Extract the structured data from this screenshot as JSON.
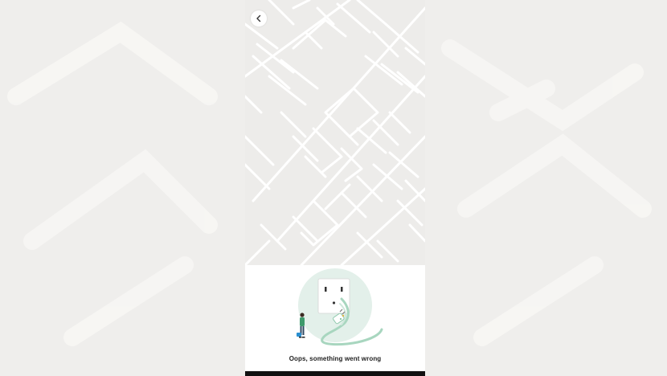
{
  "screen": {
    "back_button": {
      "icon": "chevron-left-icon"
    },
    "error": {
      "message": "Oops, something went wrong"
    },
    "illustration": {
      "icons": [
        "wall-outlet-icon",
        "unplugged-cable-icon",
        "person-icon"
      ],
      "accent_color": "#d8ebe2",
      "line_color": "#9fd1b8"
    }
  },
  "colors": {
    "map_background": "#edecea",
    "map_streets": "#ffffff",
    "sheet_background": "#ffffff",
    "text": "#222222"
  }
}
